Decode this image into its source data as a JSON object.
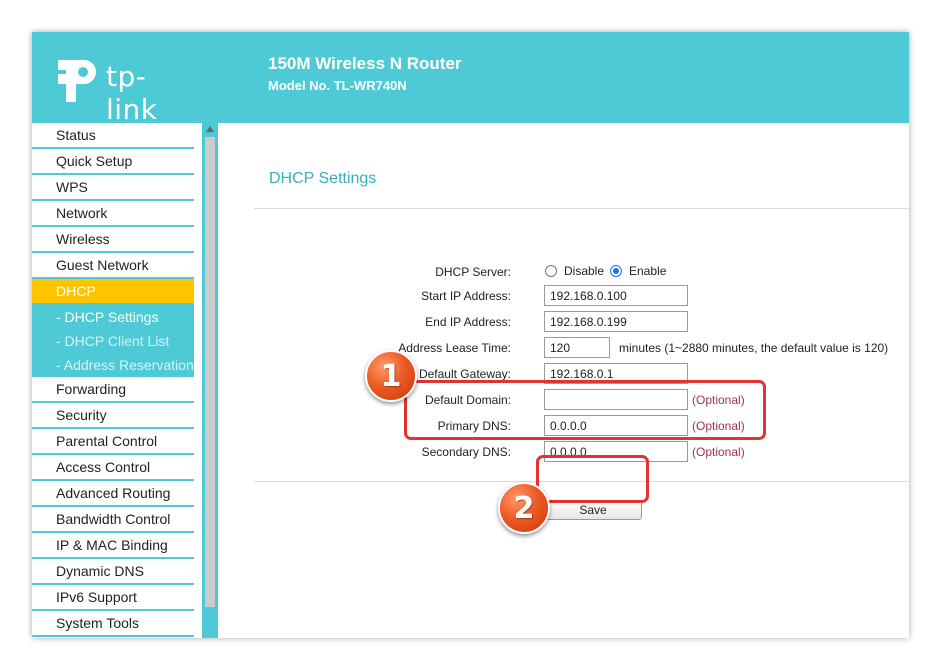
{
  "header": {
    "logo_text": "tp-link",
    "title": "150M Wireless N Router",
    "model": "Model No. TL-WR740N"
  },
  "sidebar": {
    "items_top": [
      "Status",
      "Quick Setup",
      "WPS",
      "Network",
      "Wireless",
      "Guest Network"
    ],
    "active": "DHCP",
    "sub_items": [
      "- DHCP Settings",
      "- DHCP Client List",
      "- Address Reservation"
    ],
    "items_bottom": [
      "Forwarding",
      "Security",
      "Parental Control",
      "Access Control",
      "Advanced Routing",
      "Bandwidth Control",
      "IP & MAC Binding",
      "Dynamic DNS",
      "IPv6 Support",
      "System Tools"
    ]
  },
  "section_title": "DHCP Settings",
  "form": {
    "dhcp_server_label": "DHCP Server:",
    "disable_label": "Disable",
    "enable_label": "Enable",
    "dhcp_server_value": "Enable",
    "start_ip_label": "Start IP Address:",
    "start_ip": "192.168.0.100",
    "end_ip_label": "End IP Address:",
    "end_ip": "192.168.0.199",
    "lease_label": "Address Lease Time:",
    "lease": "120",
    "lease_hint": "minutes (1~2880 minutes, the default value is 120)",
    "gateway_label": "Default Gateway:",
    "gateway": "192.168.0.1",
    "domain_label": "Default Domain:",
    "domain": "",
    "primary_dns_label": "Primary DNS:",
    "primary_dns": "0.0.0.0",
    "secondary_dns_label": "Secondary DNS:",
    "secondary_dns": "0.0.0.0",
    "optional": "(Optional)"
  },
  "save_label": "Save",
  "annotations": {
    "marker1": "1",
    "marker2": "2",
    "highlight_color": "#e23232"
  },
  "colors": {
    "brand": "#4dcad5",
    "active_menu": "#ffc400",
    "title": "#39aebb",
    "optional": "#a0305a"
  }
}
